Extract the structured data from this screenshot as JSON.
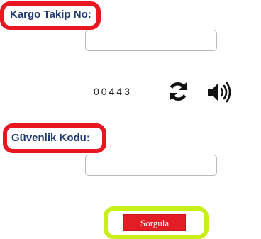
{
  "form": {
    "tracking_label": "Kargo Takip No:",
    "tracking_value": "",
    "captcha_code": "00443",
    "security_label": "Güvenlik Kodu:",
    "security_value": "",
    "submit_label": "Sorgula"
  },
  "icons": {
    "refresh": "refresh-icon",
    "audio": "speaker-icon"
  },
  "colors": {
    "highlight_red": "#e8161f",
    "highlight_green": "#c7f019",
    "label_text": "#1f3a6e",
    "button_red": "#e31d25"
  }
}
